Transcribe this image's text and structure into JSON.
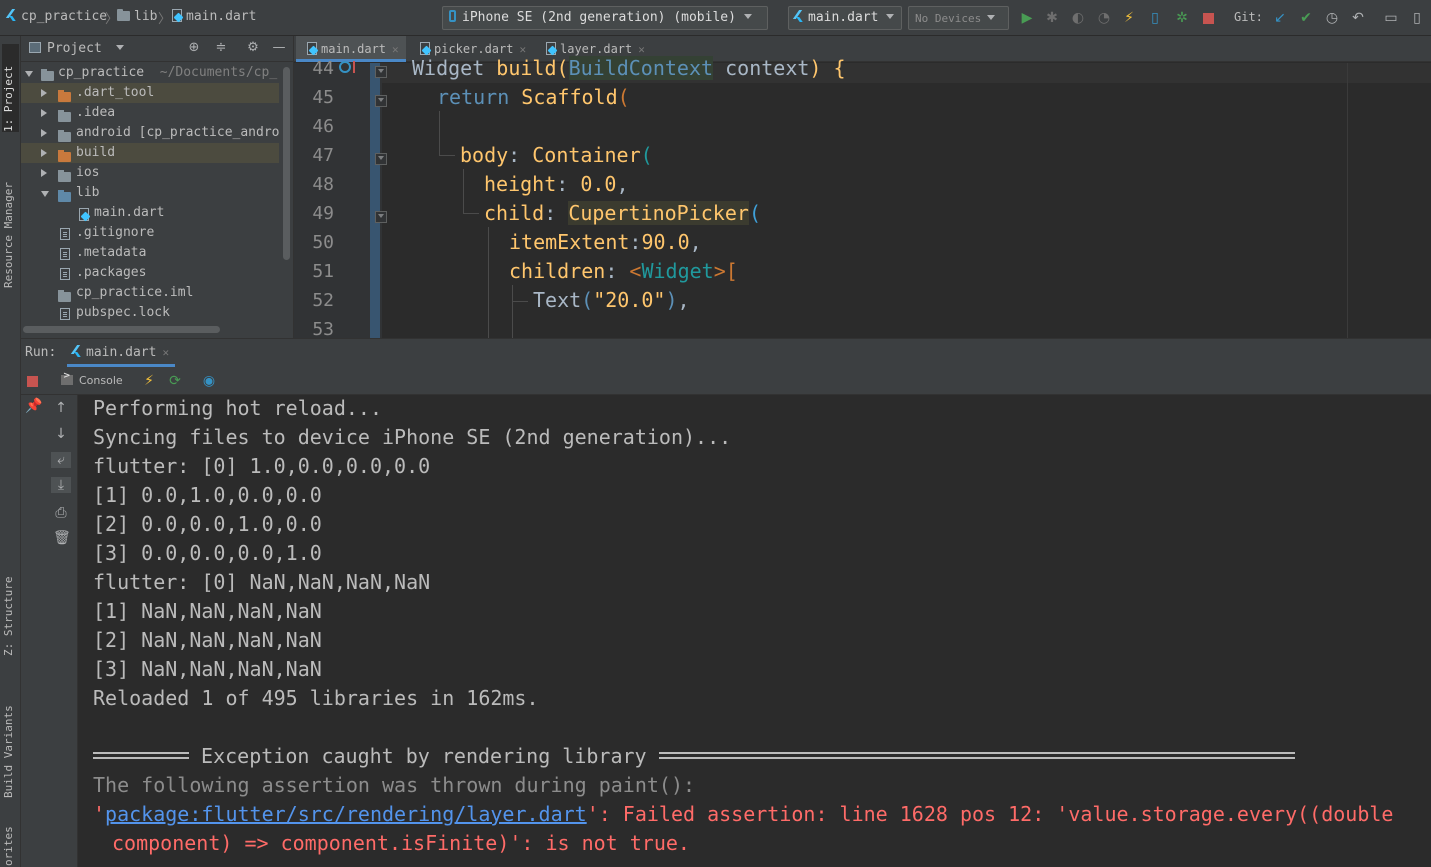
{
  "toolbar": {
    "breadcrumb": [
      "cp_practice",
      "lib",
      "main.dart"
    ],
    "device_selector": "iPhone SE (2nd generation) (mobile)",
    "run_config": "main.dart",
    "target_selector": "No Devices",
    "git_label": "Git:",
    "icons": [
      "run-icon",
      "debug-icon",
      "coverage-icon",
      "profile-icon",
      "hot-reload-icon",
      "device-icon",
      "bug-icon",
      "stop-icon",
      "git-update-icon",
      "git-commit-icon",
      "history-icon",
      "rollback-icon",
      "terminal-icon",
      "device-manager-icon"
    ]
  },
  "left_strip": {
    "tabs": [
      "1: Project",
      "Resource Manager",
      "Z: Structure",
      "Build Variants",
      "orites"
    ]
  },
  "project": {
    "title": "Project",
    "tree": [
      {
        "label": "cp_practice",
        "sub": "~/Documents/cp_",
        "type": "root",
        "depth": 0,
        "expanded": true
      },
      {
        "label": ".dart_tool",
        "type": "folder-orange",
        "depth": 1,
        "expanded": false,
        "highlight": true
      },
      {
        "label": ".idea",
        "type": "folder-gray",
        "depth": 1,
        "expanded": false
      },
      {
        "label": "android [cp_practice_andro",
        "type": "folder-gray",
        "depth": 1,
        "expanded": false
      },
      {
        "label": "build",
        "type": "folder-orange",
        "depth": 1,
        "expanded": false,
        "highlight": true
      },
      {
        "label": "ios",
        "type": "folder-gray",
        "depth": 1,
        "expanded": false
      },
      {
        "label": "lib",
        "type": "folder-blue",
        "depth": 1,
        "expanded": true
      },
      {
        "label": "main.dart",
        "type": "dart",
        "depth": 2
      },
      {
        "label": ".gitignore",
        "type": "file",
        "depth": 1
      },
      {
        "label": ".metadata",
        "type": "file",
        "depth": 1
      },
      {
        "label": ".packages",
        "type": "file",
        "depth": 1
      },
      {
        "label": "cp_practice.iml",
        "type": "iml",
        "depth": 1
      },
      {
        "label": "pubspec.lock",
        "type": "file",
        "depth": 1
      }
    ]
  },
  "editor": {
    "tabs": [
      "main.dart",
      "picker.dart",
      "layer.dart"
    ],
    "line_numbers": [
      "44",
      "45",
      "46",
      "47",
      "48",
      "49",
      "50",
      "51",
      "52",
      "53"
    ],
    "code": {
      "l44": [
        "Widget",
        "build",
        "(",
        "BuildContext",
        "context",
        ")",
        "{"
      ],
      "l45": [
        "return",
        "Scaffold",
        "("
      ],
      "l47": [
        "body",
        ":",
        "Container",
        "("
      ],
      "l48": [
        "height",
        ":",
        "0.0",
        ","
      ],
      "l49": [
        "child",
        ":",
        "CupertinoPicker",
        "("
      ],
      "l50": [
        "itemExtent",
        ":",
        "90.0",
        ","
      ],
      "l51": [
        "children",
        ":",
        "<",
        "Widget",
        ">",
        "["
      ],
      "l52": [
        "Text",
        "(",
        "\"20.0\"",
        ")",
        ","
      ]
    }
  },
  "run": {
    "label": "Run:",
    "tab": "main.dart",
    "console_label": "Console",
    "output": [
      {
        "text": "Performing hot reload...",
        "style": "normal"
      },
      {
        "text": "Syncing files to device iPhone SE (2nd generation)...",
        "style": "normal"
      },
      {
        "text": "flutter: [0] 1.0,0.0,0.0,0.0",
        "style": "normal"
      },
      {
        "text": "[1] 0.0,1.0,0.0,0.0",
        "style": "normal"
      },
      {
        "text": "[2] 0.0,0.0,1.0,0.0",
        "style": "normal"
      },
      {
        "text": "[3] 0.0,0.0,0.0,1.0",
        "style": "normal"
      },
      {
        "text": "flutter: [0] NaN,NaN,NaN,NaN",
        "style": "normal"
      },
      {
        "text": "[1] NaN,NaN,NaN,NaN",
        "style": "normal"
      },
      {
        "text": "[2] NaN,NaN,NaN,NaN",
        "style": "normal"
      },
      {
        "text": "[3] NaN,NaN,NaN,NaN",
        "style": "normal"
      },
      {
        "text": "Reloaded 1 of 495 libraries in 162ms.",
        "style": "normal"
      }
    ],
    "exception_title": "Exception caught by rendering library",
    "assertion_intro": "The following assertion was thrown during paint():",
    "error_quote_open": "'",
    "error_link": "package:flutter/src/rendering/layer.dart",
    "error_rest": "': Failed assertion: line 1628 pos 12: 'value.storage.every((double",
    "error_line2": "component) => component.isFinite)': is not true."
  },
  "colors": {
    "panel_bg": "#3c3f41",
    "editor_bg": "#2b2b2b",
    "error_red": "#ff6b68",
    "link_blue": "#5394ec",
    "accent": "#4a88c7"
  }
}
